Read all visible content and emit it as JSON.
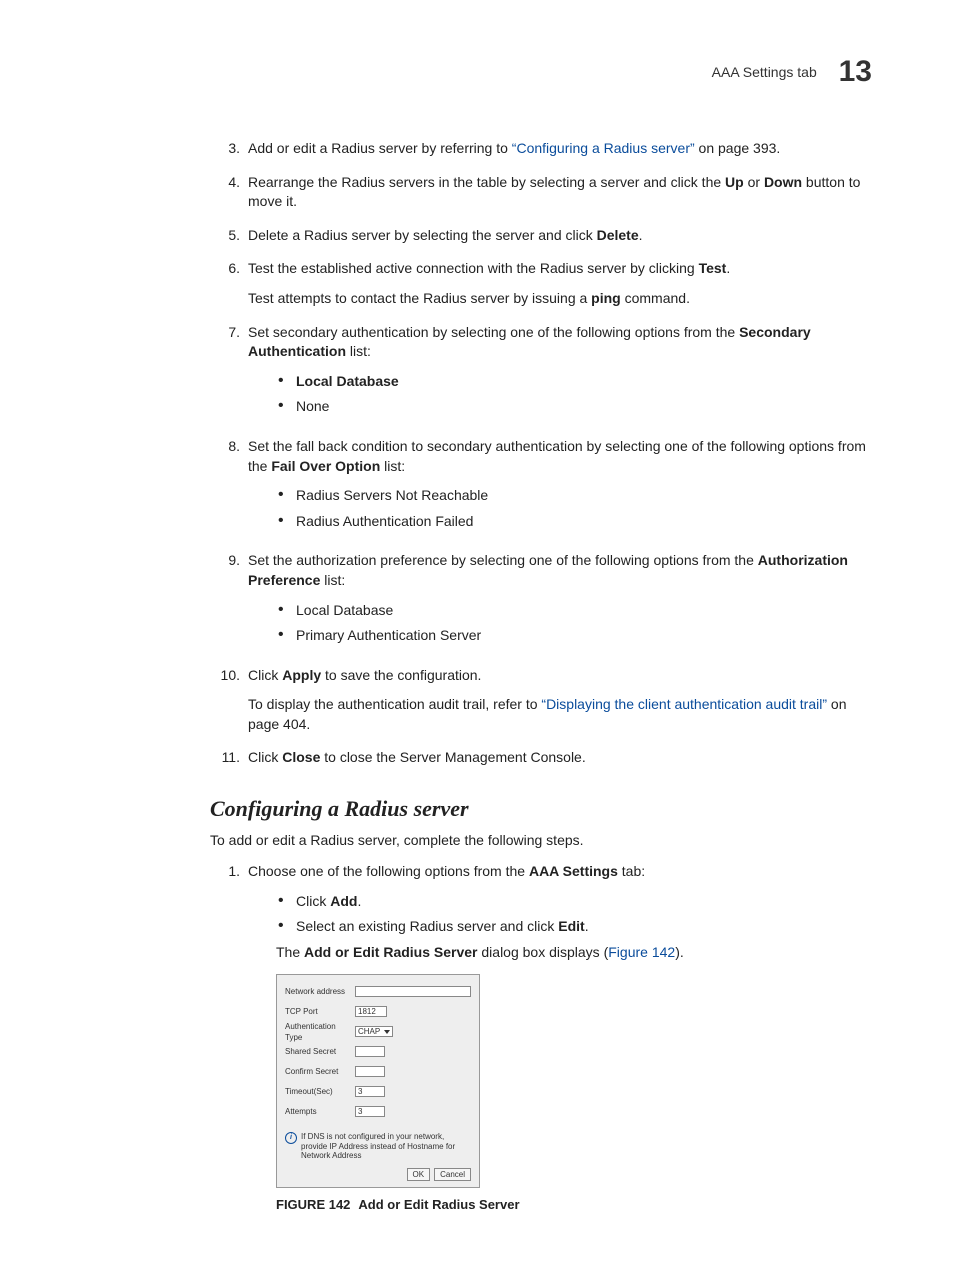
{
  "header": {
    "tab_label": "AAA Settings tab",
    "chapter_number": "13"
  },
  "steps_a": {
    "s3": {
      "num": "3.",
      "t1": "Add or edit a Radius server by referring to ",
      "link": "“Configuring a Radius server”",
      "t2": " on page 393."
    },
    "s4": {
      "num": "4.",
      "t1": "Rearrange the Radius servers in the table by selecting a server and click the ",
      "b1": "Up",
      "t2": " or ",
      "b2": "Down",
      "t3": " button to move it."
    },
    "s5": {
      "num": "5.",
      "t1": "Delete a Radius server by selecting the server and click ",
      "b1": "Delete",
      "t2": "."
    },
    "s6": {
      "num": "6.",
      "t1": "Test the established active connection with the Radius server by clicking ",
      "b1": "Test",
      "t1b": ".",
      "p2a": "Test attempts to contact the Radius server by issuing a ",
      "p2b": "ping",
      "p2c": " command."
    },
    "s7": {
      "num": "7.",
      "t1": "Set secondary authentication by selecting one of the following options from the ",
      "b1": "Secondary Authentication",
      "t2": " list:",
      "bullets": [
        "Local Database",
        "None"
      ],
      "bullet_bold": [
        true,
        false
      ]
    },
    "s8": {
      "num": "8.",
      "t1": "Set the fall back condition to secondary authentication by selecting one of the following options from the ",
      "b1": "Fail Over Option",
      "t2": " list:",
      "bullets": [
        "Radius Servers Not Reachable",
        "Radius Authentication Failed"
      ]
    },
    "s9": {
      "num": "9.",
      "t1": "Set the authorization preference by selecting one of the following options from the ",
      "b1": "Authorization Preference",
      "t2": " list:",
      "bullets": [
        "Local Database",
        "Primary Authentication Server"
      ]
    },
    "s10": {
      "num": "10.",
      "t1": "Click ",
      "b1": "Apply",
      "t2": " to save the configuration.",
      "p2a": "To display the authentication audit trail, refer to ",
      "link": "“Displaying the client authentication audit trail”",
      "p2b": " on page 404."
    },
    "s11": {
      "num": "11.",
      "t1": "Click ",
      "b1": "Close",
      "t2": " to close the Server Management Console."
    }
  },
  "subhead": "Configuring a Radius server",
  "intro": "To add or edit a Radius server, complete the following steps.",
  "steps_b": {
    "s1": {
      "num": "1.",
      "t1": "Choose one of the following options from the ",
      "b1": "AAA Settings",
      "t2": " tab:",
      "bullet1a": "Click ",
      "bullet1b": "Add",
      "bullet1c": ".",
      "bullet2a": "Select an existing Radius server and click ",
      "bullet2b": "Edit",
      "bullet2c": ".",
      "p2a": "The ",
      "p2b": "Add or Edit Radius Server",
      "p2c": " dialog box displays (",
      "link": "Figure 142",
      "p2d": ")."
    }
  },
  "dialog": {
    "network_label": "Network address",
    "network_value": "",
    "tcp_label": "TCP Port",
    "tcp_value": "1812",
    "auth_label": "Authentication Type",
    "auth_value": "CHAP",
    "secret_label": "Shared Secret",
    "secret_value": "",
    "confirm_label": "Confirm Secret",
    "confirm_value": "",
    "timeout_label": "Timeout(Sec)",
    "timeout_value": "3",
    "attempts_label": "Attempts",
    "attempts_value": "3",
    "note": "If DNS is not configured in your network, provide IP Address instead of Hostname for Network Address",
    "ok": "OK",
    "cancel": "Cancel"
  },
  "caption": {
    "figno": "FIGURE 142",
    "title": "Add or Edit Radius Server"
  }
}
